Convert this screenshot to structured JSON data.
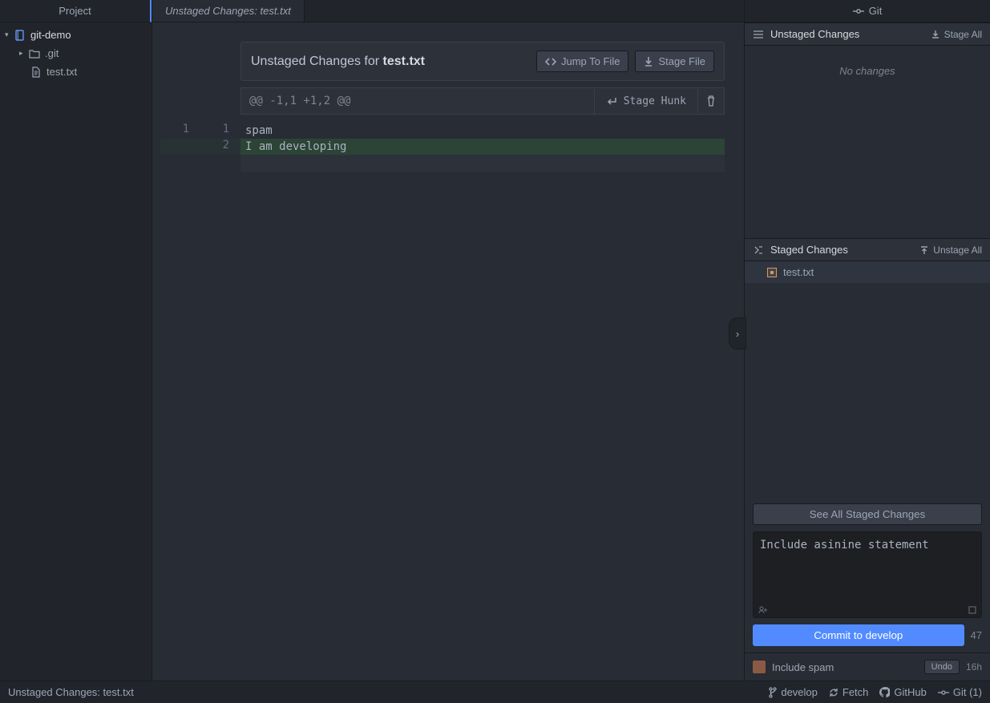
{
  "sidebar": {
    "title": "Project",
    "root": "git-demo",
    "items": [
      {
        "label": ".git"
      },
      {
        "label": "test.txt"
      }
    ]
  },
  "tab": {
    "label": "Unstaged Changes: test.txt"
  },
  "diff": {
    "title_prefix": "Unstaged Changes for ",
    "title_file": "test.txt",
    "jump": "Jump To File",
    "stage_file": "Stage File",
    "hunk_range": "@@ -1,1 +1,2 @@",
    "stage_hunk": "Stage Hunk",
    "lines": [
      {
        "old": "1",
        "new": "1",
        "text": "spam",
        "added": false
      },
      {
        "old": "",
        "new": "2",
        "text": "I am developing",
        "added": true
      }
    ]
  },
  "git": {
    "title": "Git",
    "unstaged": {
      "title": "Unstaged Changes",
      "action": "Stage All",
      "empty": "No changes"
    },
    "staged": {
      "title": "Staged Changes",
      "action": "Unstage All",
      "files": [
        {
          "name": "test.txt"
        }
      ],
      "see_all": "See All Staged Changes"
    },
    "commit": {
      "message": "Include asinine statement",
      "button": "Commit to develop",
      "counter": "47"
    },
    "recent": {
      "message": "Include spam",
      "undo": "Undo",
      "time": "16h"
    }
  },
  "status": {
    "left": "Unstaged Changes: test.txt",
    "branch": "develop",
    "fetch": "Fetch",
    "github": "GitHub",
    "git": "Git (1)"
  }
}
